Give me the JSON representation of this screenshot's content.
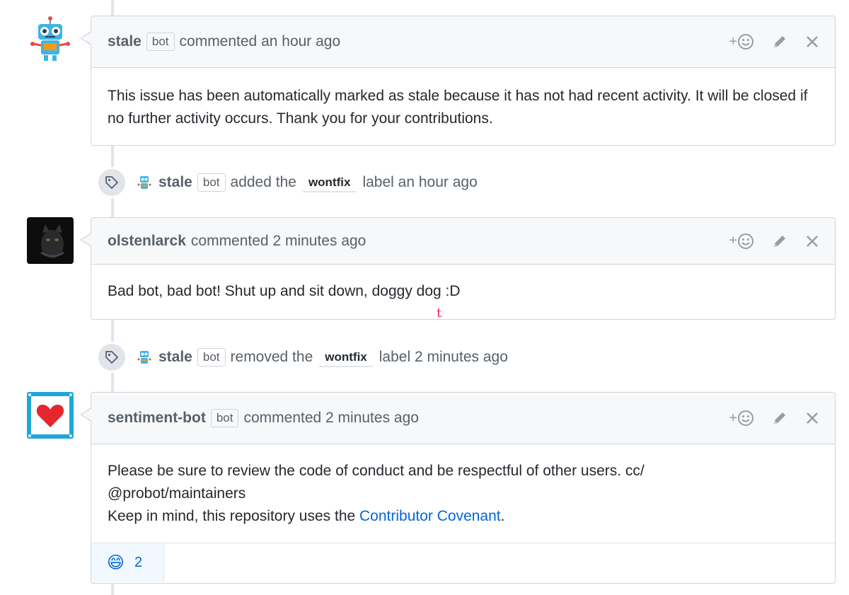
{
  "comments": [
    {
      "author": "stale",
      "bot_label": "bot",
      "meta": "commented an hour ago",
      "body": "This issue has been automatically marked as stale because it has not had recent activity. It will be closed if no further activity occurs. Thank you for your contributions."
    },
    {
      "author": "olstenlarck",
      "meta": "commented 2 minutes ago",
      "body": "Bad bot, bad bot! Shut up and sit down, doggy dog :D"
    },
    {
      "author": "sentiment-bot",
      "bot_label": "bot",
      "meta": "commented 2 minutes ago",
      "body_line1": "Please be sure to review the code of conduct and be respectful of other users. cc/",
      "body_line2": "@probot/maintainers",
      "body_line3_prefix": "Keep in mind, this repository uses the ",
      "body_link": "Contributor Covenant",
      "body_line3_suffix": ".",
      "reaction_emoji": "😄",
      "reaction_count": "2"
    }
  ],
  "events": [
    {
      "actor": "stale",
      "bot_label": "bot",
      "action": "added the",
      "label": "wontfix",
      "suffix": "label an hour ago"
    },
    {
      "actor": "stale",
      "bot_label": "bot",
      "action": "removed the",
      "label": "wontfix",
      "suffix": "label 2 minutes ago"
    }
  ],
  "header_actions": {
    "reaction_icon": "add-reaction-icon",
    "edit_icon": "pencil-icon",
    "delete_icon": "close-icon",
    "reaction_plus": "+"
  },
  "cursor_glyph": "t",
  "colors": {
    "link": "#0366d6",
    "header_bg": "#f6f8fa",
    "border": "#d1d5da",
    "heart": "#e6262f",
    "heart_frame": "#1fa7d8"
  }
}
